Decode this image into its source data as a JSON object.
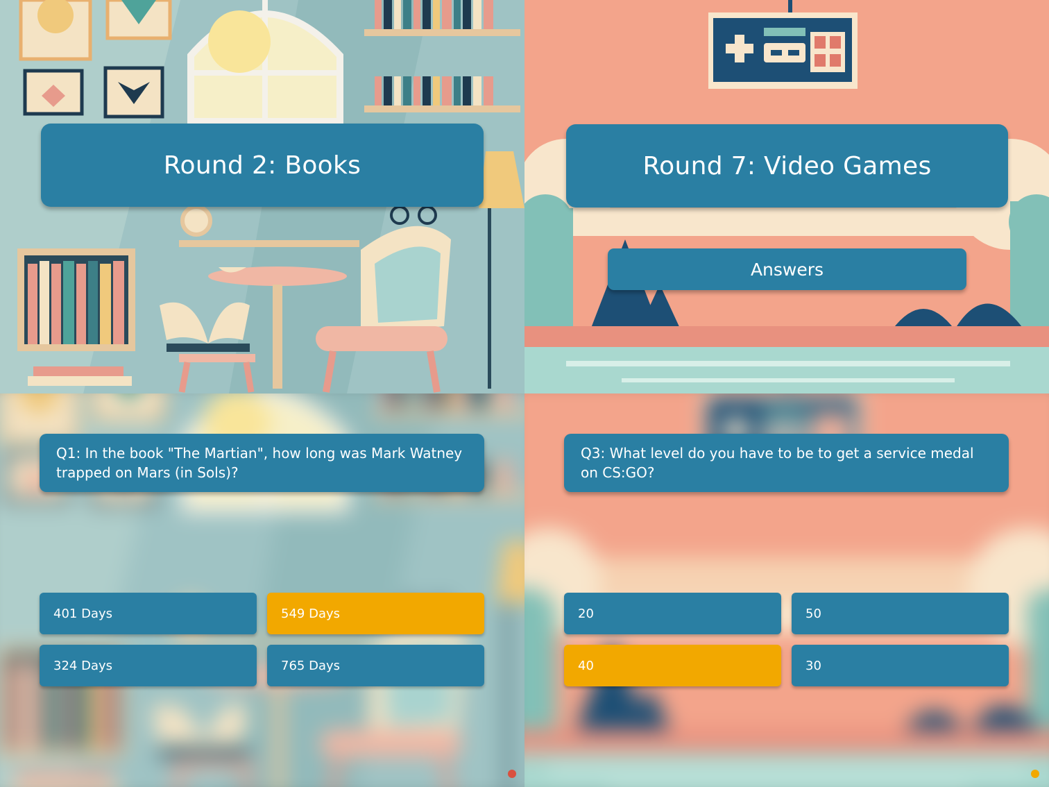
{
  "colors": {
    "panel": "#2a7fa3",
    "selected": "#f2a800",
    "text": "#ffffff",
    "books_dot": "#d9503f",
    "games_dot": "#f2a800"
  },
  "slides": {
    "books_title": {
      "title": "Round 2: Books"
    },
    "games_title": {
      "title": "Round 7: Video Games",
      "answers_button": "Answers"
    },
    "books_question": {
      "question": "Q1: In the book \"The Martian\", how long was Mark Watney trapped on Mars (in Sols)?",
      "options": [
        {
          "label": "401 Days",
          "selected": false
        },
        {
          "label": "549 Days",
          "selected": true
        },
        {
          "label": "324 Days",
          "selected": false
        },
        {
          "label": "765 Days",
          "selected": false
        }
      ]
    },
    "games_question": {
      "question": "Q3: What level do you have to be to get a service medal on CS:GO?",
      "options": [
        {
          "label": "20",
          "selected": false
        },
        {
          "label": "50",
          "selected": false
        },
        {
          "label": "40",
          "selected": true
        },
        {
          "label": "30",
          "selected": false
        }
      ]
    }
  }
}
